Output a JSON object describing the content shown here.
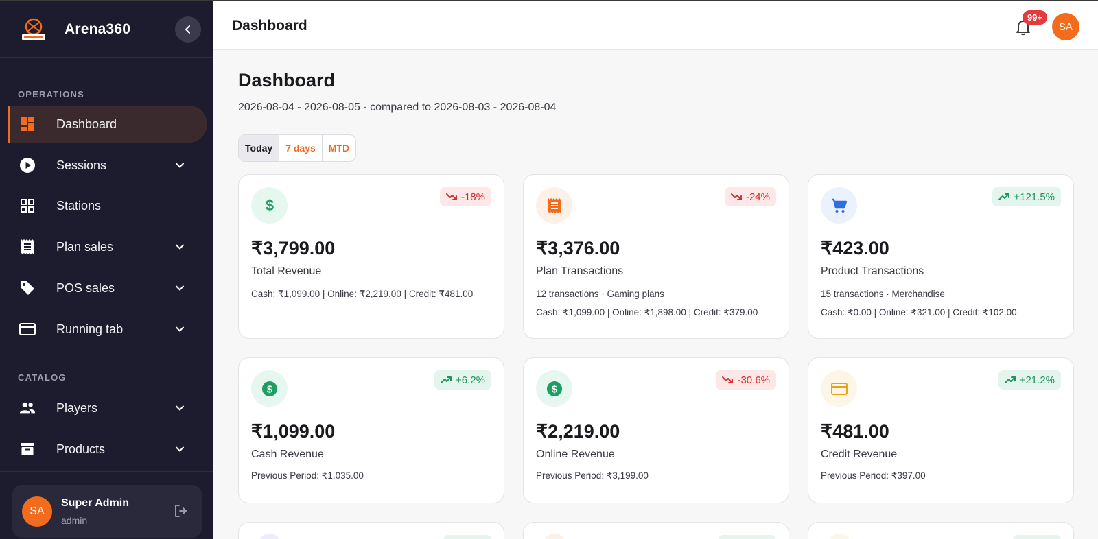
{
  "app": {
    "name": "Arena360",
    "logo_text": "Arena360"
  },
  "sidebar": {
    "sections": [
      {
        "label": "OPERATIONS"
      },
      {
        "label": "CATALOG"
      }
    ],
    "items": [
      {
        "label": "Dashboard",
        "icon": "dashboard-icon",
        "active": true
      },
      {
        "label": "Sessions",
        "icon": "play-circle-icon"
      },
      {
        "label": "Stations",
        "icon": "grid-icon"
      },
      {
        "label": "Plan sales",
        "icon": "receipt-icon"
      },
      {
        "label": "POS sales",
        "icon": "tag-icon"
      },
      {
        "label": "Running tab",
        "icon": "credit-card-icon"
      },
      {
        "label": "Players",
        "icon": "people-icon"
      },
      {
        "label": "Products",
        "icon": "archive-icon"
      }
    ]
  },
  "user": {
    "initials": "SA",
    "name": "Super Admin",
    "role": "admin"
  },
  "header": {
    "title": "Dashboard",
    "notifications": "99+",
    "avatar_initials": "SA"
  },
  "main": {
    "title": "Dashboard",
    "date_range": "2026-08-04 - 2026-08-05 · compared to 2026-08-03 - 2026-08-04",
    "tabs": [
      {
        "label": "Today",
        "active": true
      },
      {
        "label": "7 days"
      },
      {
        "label": "MTD"
      }
    ],
    "cards": [
      {
        "icon": "dollar-icon",
        "delta": "-18%",
        "trend": "down",
        "value": "₹3,799.00",
        "label": "Total Revenue",
        "meta1": "Cash: ₹1,099.00 | Online: ₹2,219.00 | Credit: ₹481.00",
        "meta2": ""
      },
      {
        "icon": "receipt-icon",
        "delta": "-24%",
        "trend": "down",
        "value": "₹3,376.00",
        "label": "Plan Transactions",
        "meta1": "12 transactions · Gaming plans",
        "meta2": "Cash: ₹1,099.00 | Online: ₹1,898.00 | Credit: ₹379.00"
      },
      {
        "icon": "cart-icon",
        "delta": "+121.5%",
        "trend": "up",
        "value": "₹423.00",
        "label": "Product Transactions",
        "meta1": "15 transactions · Merchandise",
        "meta2": "Cash: ₹0.00 | Online: ₹321.00 | Credit: ₹102.00"
      },
      {
        "icon": "dollar-circle-icon",
        "delta": "+6.2%",
        "trend": "up",
        "value": "₹1,099.00",
        "label": "Cash Revenue",
        "meta1": "Previous Period: ₹1,035.00",
        "meta2": ""
      },
      {
        "icon": "dollar-circle-icon",
        "delta": "-30.6%",
        "trend": "down",
        "value": "₹2,219.00",
        "label": "Online Revenue",
        "meta1": "Previous Period: ₹3,199.00",
        "meta2": ""
      },
      {
        "icon": "credit-card-icon",
        "delta": "+21.2%",
        "trend": "up",
        "value": "₹481.00",
        "label": "Credit Revenue",
        "meta1": "Previous Period: ₹397.00",
        "meta2": ""
      }
    ]
  },
  "colors": {
    "accent": "#f36b1c",
    "sidebar_bg": "#1d1c2e",
    "down": "#d52c2c",
    "up": "#21945c"
  }
}
